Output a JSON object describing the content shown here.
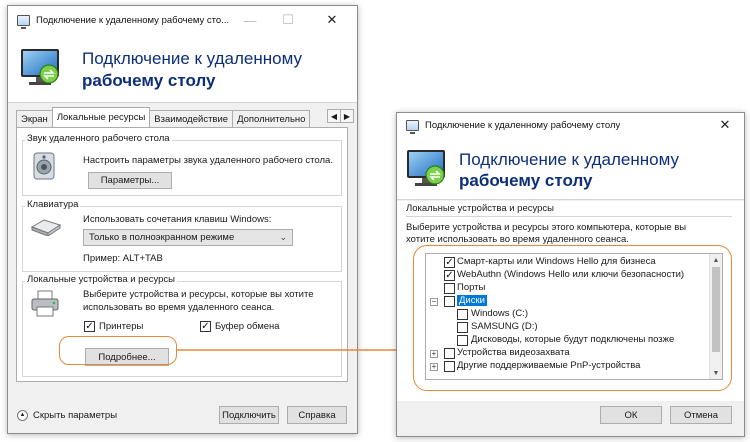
{
  "left_window": {
    "title": "Подключение к удаленному рабочему сто...",
    "banner": {
      "line1": "Подключение к удаленному",
      "line2": "рабочему столу"
    },
    "tabs": [
      "Экран",
      "Локальные ресурсы",
      "Взаимодействие",
      "Дополнительно"
    ],
    "active_tab": "Локальные ресурсы",
    "sound_group": {
      "label": "Звук удаленного рабочего стола",
      "description": "Настроить параметры звука удаленного рабочего стола.",
      "button": "Параметры..."
    },
    "keyboard_group": {
      "label": "Клавиатура",
      "description": "Использовать сочетания клавиш Windows:",
      "select_value": "Только в полноэкранном режиме",
      "example": "Пример: ALT+TAB"
    },
    "devices_group": {
      "label": "Локальные устройства и ресурсы",
      "description_line1": "Выберите устройства и ресурсы, которые вы хотите",
      "description_line2": "использовать во время удаленного сеанса.",
      "printers_label": "Принтеры",
      "printers_checked": true,
      "clipboard_label": "Буфер обмена",
      "clipboard_checked": true,
      "more_button": "Подробнее..."
    },
    "hide_options": "Скрыть параметры",
    "connect_button": "Подключить",
    "help_button": "Справка"
  },
  "right_window": {
    "title": "Подключение к удаленному рабочему столу",
    "banner": {
      "line1": "Подключение к удаленному",
      "line2": "рабочему столу"
    },
    "section_label": "Локальные устройства и ресурсы",
    "description_line1": "Выберите устройства и ресурсы этого компьютера, которые вы",
    "description_line2": "хотите использовать во время удаленного сеанса.",
    "tree": [
      {
        "label": "Смарт-карты или Windows Hello для бизнеса",
        "checked": true,
        "expander": "",
        "level": 0
      },
      {
        "label": "WebAuthn (Windows Hello или ключи безопасности)",
        "checked": true,
        "expander": "",
        "level": 0
      },
      {
        "label": "Порты",
        "checked": false,
        "expander": "",
        "level": 0
      },
      {
        "label": "Диски",
        "checked": false,
        "expander": "−",
        "level": 0,
        "selected": true
      },
      {
        "label": "Windows (C:)",
        "checked": false,
        "expander": "",
        "level": 1
      },
      {
        "label": "SAMSUNG (D:)",
        "checked": false,
        "expander": "",
        "level": 1
      },
      {
        "label": "Дисководы, которые будут подключены позже",
        "checked": false,
        "expander": "",
        "level": 1
      },
      {
        "label": "Устройства видеозахвата",
        "checked": false,
        "expander": "+",
        "level": 0
      },
      {
        "label": "Другие поддерживаемые PnP-устройства",
        "checked": false,
        "expander": "+",
        "level": 0
      }
    ],
    "ok_button": "ОК",
    "cancel_button": "Отмена"
  },
  "icons": [
    "rdp-logo-icon",
    "speaker-icon",
    "keyboard-icon",
    "printer-icon",
    "close-icon",
    "minimize-icon",
    "maximize-icon",
    "chevron-up-icon"
  ],
  "colors": {
    "accent": "#0078d7",
    "callout": "#e8883a",
    "banner_text": "#0d2f7a"
  }
}
